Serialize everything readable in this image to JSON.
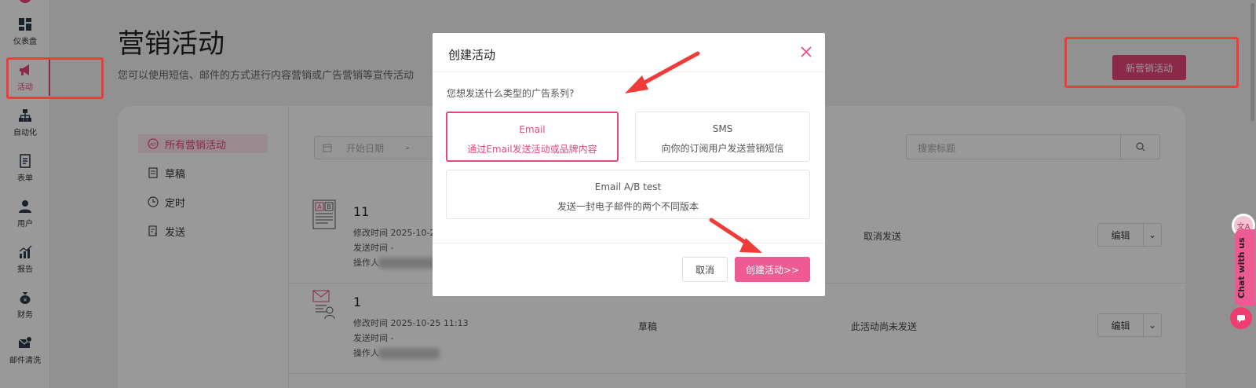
{
  "sidebar": {
    "items": [
      {
        "label": "仪表盘",
        "icon": "dashboard-icon"
      },
      {
        "label": "活动",
        "icon": "megaphone-icon",
        "active": true
      },
      {
        "label": "自动化",
        "icon": "automation-icon"
      },
      {
        "label": "表单",
        "icon": "form-icon"
      },
      {
        "label": "用户",
        "icon": "user-icon"
      },
      {
        "label": "报告",
        "icon": "report-icon"
      },
      {
        "label": "财务",
        "icon": "finance-icon"
      },
      {
        "label": "邮件清洗",
        "icon": "email-clean-icon"
      }
    ]
  },
  "header": {
    "title": "营销活动",
    "description": "您可以使用短信、邮件的方式进行内容营销或广告营销等宣传活动",
    "new_button": "新营销活动"
  },
  "filters": {
    "items": [
      "所有营销活动",
      "草稿",
      "定时",
      "发送"
    ]
  },
  "toolbar": {
    "start_date_placeholder": "开始日期",
    "date_separator": "-",
    "search_placeholder": "搜索标题"
  },
  "rows": [
    {
      "name": "11",
      "modified": "修改时间 2025-10-2",
      "sent": "发送时间 -",
      "operator": "操作人",
      "status": "",
      "note": "取消发送",
      "edit": "编辑"
    },
    {
      "name": "1",
      "modified": "修改时间 2025-10-25 11:13",
      "sent": "发送时间 -",
      "operator": "操作人",
      "status": "草稿",
      "note": "此活动尚未发送",
      "edit": "编辑"
    }
  ],
  "modal": {
    "title": "创建活动",
    "question": "您想发送什么类型的广告系列?",
    "options": [
      {
        "title": "Email",
        "desc": "通过Email发送活动或品牌内容",
        "selected": true
      },
      {
        "title": "SMS",
        "desc": "向你的订阅用户发送营销短信",
        "selected": false
      },
      {
        "title": "Email A/B test",
        "desc": "发送一封电子邮件的两个不同版本",
        "selected": false
      }
    ],
    "cancel_label": "取消",
    "create_label": "创建活动>>"
  },
  "chat": {
    "label": "Chat with us"
  },
  "colors": {
    "accent": "#e8457a",
    "highlight": "#f03b3b"
  }
}
